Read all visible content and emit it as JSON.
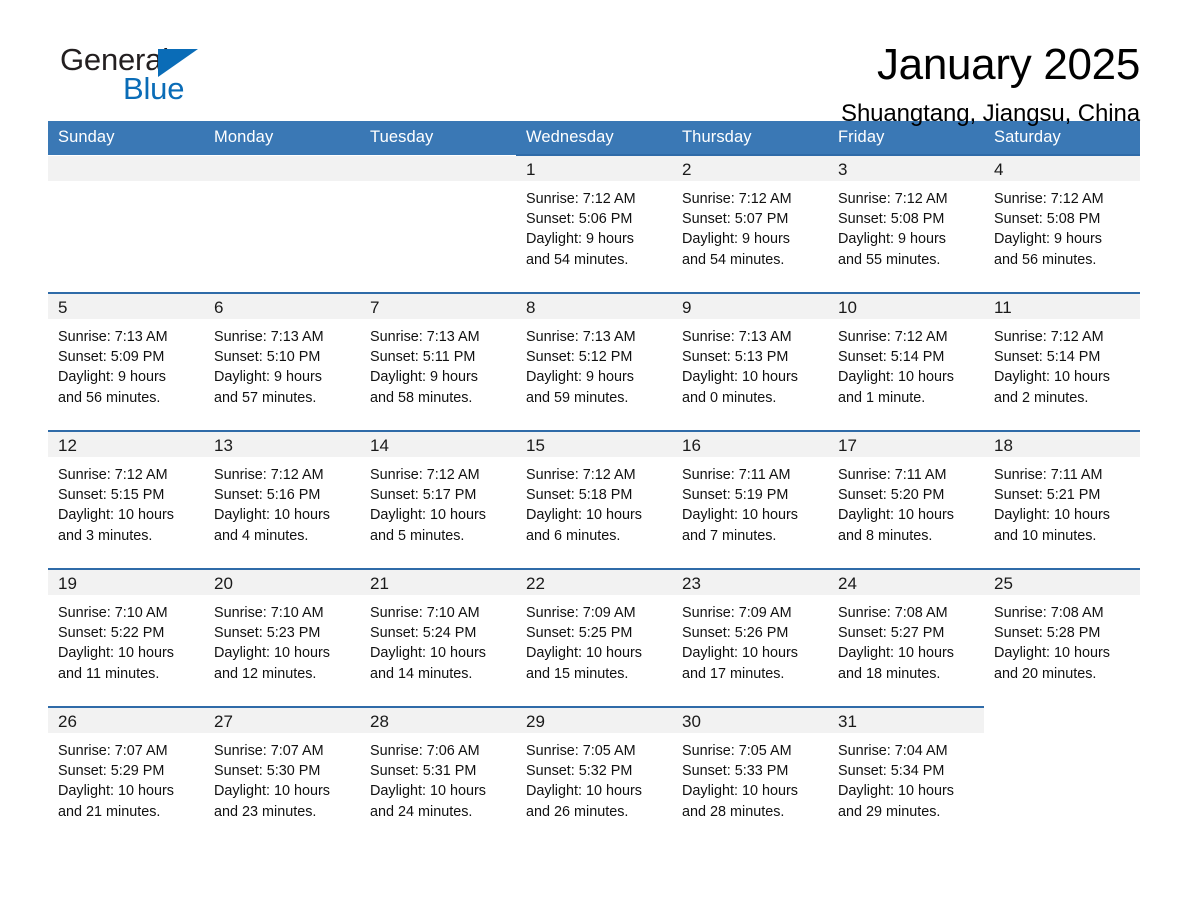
{
  "brand": {
    "name_part1": "General",
    "name_part2": "Blue",
    "accent_color": "#0a6cb7"
  },
  "header": {
    "title": "January 2025",
    "location": "Shuangtang, Jiangsu, China"
  },
  "theme": {
    "header_row_bg": "#3a78b5",
    "row_divider": "#2f6ba8",
    "daynum_bg": "#f2f2f2"
  },
  "weekdays": [
    "Sunday",
    "Monday",
    "Tuesday",
    "Wednesday",
    "Thursday",
    "Friday",
    "Saturday"
  ],
  "weeks": [
    [
      {
        "blank": true
      },
      {
        "blank": true
      },
      {
        "blank": true
      },
      {
        "day": "1",
        "sunrise": "Sunrise: 7:12 AM",
        "sunset": "Sunset: 5:06 PM",
        "daylight_line1": "Daylight: 9 hours",
        "daylight_line2": "and 54 minutes."
      },
      {
        "day": "2",
        "sunrise": "Sunrise: 7:12 AM",
        "sunset": "Sunset: 5:07 PM",
        "daylight_line1": "Daylight: 9 hours",
        "daylight_line2": "and 54 minutes."
      },
      {
        "day": "3",
        "sunrise": "Sunrise: 7:12 AM",
        "sunset": "Sunset: 5:08 PM",
        "daylight_line1": "Daylight: 9 hours",
        "daylight_line2": "and 55 minutes."
      },
      {
        "day": "4",
        "sunrise": "Sunrise: 7:12 AM",
        "sunset": "Sunset: 5:08 PM",
        "daylight_line1": "Daylight: 9 hours",
        "daylight_line2": "and 56 minutes."
      }
    ],
    [
      {
        "day": "5",
        "sunrise": "Sunrise: 7:13 AM",
        "sunset": "Sunset: 5:09 PM",
        "daylight_line1": "Daylight: 9 hours",
        "daylight_line2": "and 56 minutes."
      },
      {
        "day": "6",
        "sunrise": "Sunrise: 7:13 AM",
        "sunset": "Sunset: 5:10 PM",
        "daylight_line1": "Daylight: 9 hours",
        "daylight_line2": "and 57 minutes."
      },
      {
        "day": "7",
        "sunrise": "Sunrise: 7:13 AM",
        "sunset": "Sunset: 5:11 PM",
        "daylight_line1": "Daylight: 9 hours",
        "daylight_line2": "and 58 minutes."
      },
      {
        "day": "8",
        "sunrise": "Sunrise: 7:13 AM",
        "sunset": "Sunset: 5:12 PM",
        "daylight_line1": "Daylight: 9 hours",
        "daylight_line2": "and 59 minutes."
      },
      {
        "day": "9",
        "sunrise": "Sunrise: 7:13 AM",
        "sunset": "Sunset: 5:13 PM",
        "daylight_line1": "Daylight: 10 hours",
        "daylight_line2": "and 0 minutes."
      },
      {
        "day": "10",
        "sunrise": "Sunrise: 7:12 AM",
        "sunset": "Sunset: 5:14 PM",
        "daylight_line1": "Daylight: 10 hours",
        "daylight_line2": "and 1 minute."
      },
      {
        "day": "11",
        "sunrise": "Sunrise: 7:12 AM",
        "sunset": "Sunset: 5:14 PM",
        "daylight_line1": "Daylight: 10 hours",
        "daylight_line2": "and 2 minutes."
      }
    ],
    [
      {
        "day": "12",
        "sunrise": "Sunrise: 7:12 AM",
        "sunset": "Sunset: 5:15 PM",
        "daylight_line1": "Daylight: 10 hours",
        "daylight_line2": "and 3 minutes."
      },
      {
        "day": "13",
        "sunrise": "Sunrise: 7:12 AM",
        "sunset": "Sunset: 5:16 PM",
        "daylight_line1": "Daylight: 10 hours",
        "daylight_line2": "and 4 minutes."
      },
      {
        "day": "14",
        "sunrise": "Sunrise: 7:12 AM",
        "sunset": "Sunset: 5:17 PM",
        "daylight_line1": "Daylight: 10 hours",
        "daylight_line2": "and 5 minutes."
      },
      {
        "day": "15",
        "sunrise": "Sunrise: 7:12 AM",
        "sunset": "Sunset: 5:18 PM",
        "daylight_line1": "Daylight: 10 hours",
        "daylight_line2": "and 6 minutes."
      },
      {
        "day": "16",
        "sunrise": "Sunrise: 7:11 AM",
        "sunset": "Sunset: 5:19 PM",
        "daylight_line1": "Daylight: 10 hours",
        "daylight_line2": "and 7 minutes."
      },
      {
        "day": "17",
        "sunrise": "Sunrise: 7:11 AM",
        "sunset": "Sunset: 5:20 PM",
        "daylight_line1": "Daylight: 10 hours",
        "daylight_line2": "and 8 minutes."
      },
      {
        "day": "18",
        "sunrise": "Sunrise: 7:11 AM",
        "sunset": "Sunset: 5:21 PM",
        "daylight_line1": "Daylight: 10 hours",
        "daylight_line2": "and 10 minutes."
      }
    ],
    [
      {
        "day": "19",
        "sunrise": "Sunrise: 7:10 AM",
        "sunset": "Sunset: 5:22 PM",
        "daylight_line1": "Daylight: 10 hours",
        "daylight_line2": "and 11 minutes."
      },
      {
        "day": "20",
        "sunrise": "Sunrise: 7:10 AM",
        "sunset": "Sunset: 5:23 PM",
        "daylight_line1": "Daylight: 10 hours",
        "daylight_line2": "and 12 minutes."
      },
      {
        "day": "21",
        "sunrise": "Sunrise: 7:10 AM",
        "sunset": "Sunset: 5:24 PM",
        "daylight_line1": "Daylight: 10 hours",
        "daylight_line2": "and 14 minutes."
      },
      {
        "day": "22",
        "sunrise": "Sunrise: 7:09 AM",
        "sunset": "Sunset: 5:25 PM",
        "daylight_line1": "Daylight: 10 hours",
        "daylight_line2": "and 15 minutes."
      },
      {
        "day": "23",
        "sunrise": "Sunrise: 7:09 AM",
        "sunset": "Sunset: 5:26 PM",
        "daylight_line1": "Daylight: 10 hours",
        "daylight_line2": "and 17 minutes."
      },
      {
        "day": "24",
        "sunrise": "Sunrise: 7:08 AM",
        "sunset": "Sunset: 5:27 PM",
        "daylight_line1": "Daylight: 10 hours",
        "daylight_line2": "and 18 minutes."
      },
      {
        "day": "25",
        "sunrise": "Sunrise: 7:08 AM",
        "sunset": "Sunset: 5:28 PM",
        "daylight_line1": "Daylight: 10 hours",
        "daylight_line2": "and 20 minutes."
      }
    ],
    [
      {
        "day": "26",
        "sunrise": "Sunrise: 7:07 AM",
        "sunset": "Sunset: 5:29 PM",
        "daylight_line1": "Daylight: 10 hours",
        "daylight_line2": "and 21 minutes."
      },
      {
        "day": "27",
        "sunrise": "Sunrise: 7:07 AM",
        "sunset": "Sunset: 5:30 PM",
        "daylight_line1": "Daylight: 10 hours",
        "daylight_line2": "and 23 minutes."
      },
      {
        "day": "28",
        "sunrise": "Sunrise: 7:06 AM",
        "sunset": "Sunset: 5:31 PM",
        "daylight_line1": "Daylight: 10 hours",
        "daylight_line2": "and 24 minutes."
      },
      {
        "day": "29",
        "sunrise": "Sunrise: 7:05 AM",
        "sunset": "Sunset: 5:32 PM",
        "daylight_line1": "Daylight: 10 hours",
        "daylight_line2": "and 26 minutes."
      },
      {
        "day": "30",
        "sunrise": "Sunrise: 7:05 AM",
        "sunset": "Sunset: 5:33 PM",
        "daylight_line1": "Daylight: 10 hours",
        "daylight_line2": "and 28 minutes."
      },
      {
        "day": "31",
        "sunrise": "Sunrise: 7:04 AM",
        "sunset": "Sunset: 5:34 PM",
        "daylight_line1": "Daylight: 10 hours",
        "daylight_line2": "and 29 minutes."
      },
      {
        "blank": true,
        "trailing": true
      }
    ]
  ]
}
